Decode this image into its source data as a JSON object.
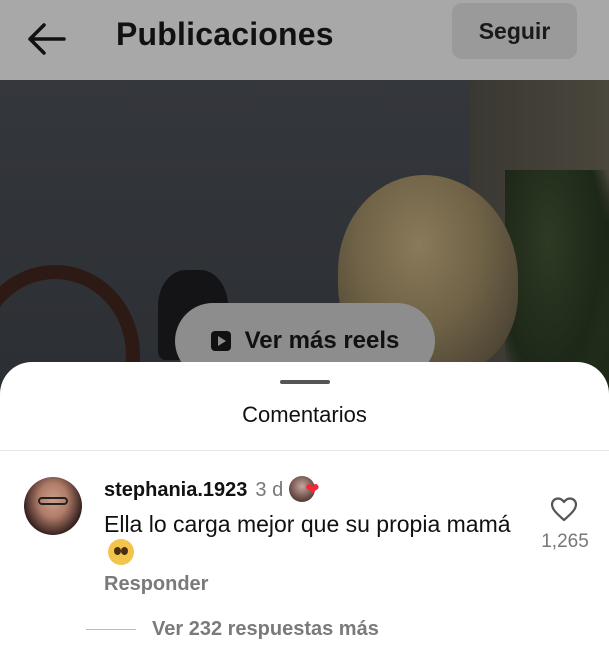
{
  "header": {
    "title": "Publicaciones",
    "follow_label": "Seguir",
    "back_icon": "arrow-left-icon"
  },
  "video": {
    "reels_button_label": "Ver más reels",
    "reels_icon": "play-square-icon"
  },
  "comments_sheet": {
    "title": "Comentarios",
    "comments": [
      {
        "username": "stephania.1923",
        "time": "3 d",
        "text": "Ella lo carga mejor que su propia mamá",
        "emoji": "pleading-face",
        "reply_label": "Responder",
        "like_count": "1,265",
        "liked_by_creator": true
      }
    ],
    "more_replies_label": "Ver 232 respuestas más"
  },
  "colors": {
    "heart_red": "#ed2b3b",
    "muted_text": "#7a7a7a"
  }
}
